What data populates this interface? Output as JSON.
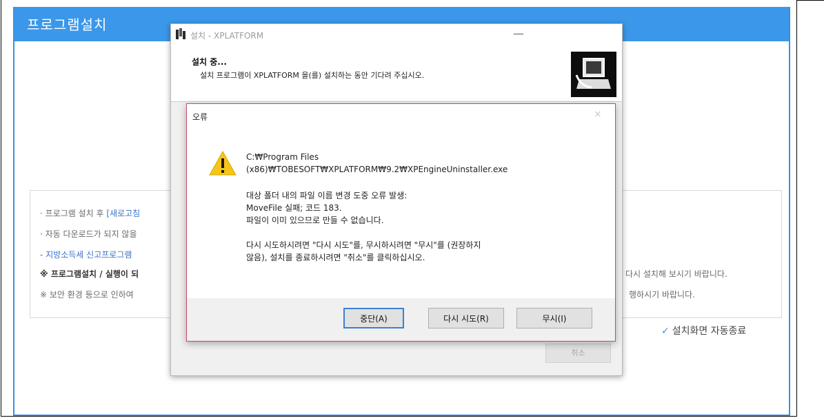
{
  "main": {
    "title": "프로그램설치",
    "info_lines": [
      {
        "prefix": "· 프로그램 설치 후 ",
        "link": "[새로고침"
      },
      {
        "text": "· 자동 다운로드가 되지 않을"
      },
      {
        "text": "- 지방소득세 신고프로그램"
      },
      {
        "text": "※ 프로그램설치 / 실행이 되"
      },
      {
        "text": "※ 보안 환경 등으로 인하여"
      }
    ],
    "info_right": [
      "다시 설치해 보시기 바랍니다.",
      "행하시기 바랍니다."
    ],
    "autoclose_label": "설치화면 자동종료",
    "checkmark": "✓"
  },
  "setup": {
    "title": "설치 - XPLATFORM",
    "minimize": "—",
    "heading": "설치 중...",
    "subheading": "설치 프로그램이 XPLATFORM 을(를) 설치하는 동안 기다려 주십시오.",
    "cancel_label": "취소"
  },
  "error": {
    "title": "오류",
    "close": "×",
    "path_line1": "C:₩Program Files",
    "path_line2": "(x86)₩TOBESOFT₩XPLATFORM₩9.2₩XPEngineUninstaller.exe",
    "msg_line1": "대상 폴더 내의 파일 이름 변경 도중 오류 발생:",
    "msg_line2": "MoveFile 실패; 코드 183.",
    "msg_line3": "파일이 이미 있으므로 만들 수 없습니다.",
    "msg_line4": "다시 시도하시려면 \"다시 시도\"를, 무시하시려면 \"무시\"를 (권장하지",
    "msg_line5": "않음), 설치를 종료하시려면 \"취소\"를 클릭하십시오.",
    "buttons": {
      "abort": "중단(A)",
      "retry": "다시 시도(R)",
      "ignore": "무시(I)"
    },
    "icon": "warning-icon"
  }
}
